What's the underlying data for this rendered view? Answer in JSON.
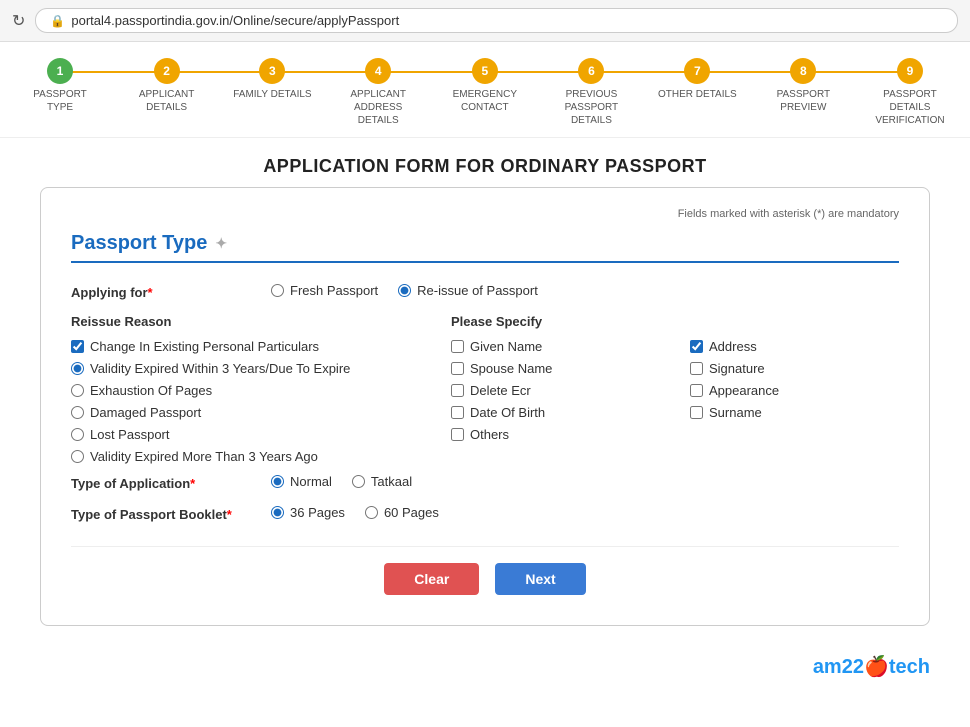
{
  "browser": {
    "url": "portal4.passportindia.gov.in/Online/secure/applyPassport",
    "refresh_icon": "↻",
    "lock_icon": "🔒"
  },
  "steps": [
    {
      "number": "1",
      "label": "PASSPORT TYPE",
      "state": "active"
    },
    {
      "number": "2",
      "label": "APPLICANT DETAILS",
      "state": "pending"
    },
    {
      "number": "3",
      "label": "FAMILY DETAILS",
      "state": "pending"
    },
    {
      "number": "4",
      "label": "APPLICANT ADDRESS DETAILS",
      "state": "pending"
    },
    {
      "number": "5",
      "label": "EMERGENCY CONTACT",
      "state": "pending"
    },
    {
      "number": "6",
      "label": "PREVIOUS PASSPORT DETAILS",
      "state": "pending"
    },
    {
      "number": "7",
      "label": "OTHER DETAILS",
      "state": "pending"
    },
    {
      "number": "8",
      "label": "PASSPORT PREVIEW",
      "state": "pending"
    },
    {
      "number": "9",
      "label": "PASSPORT DETAILS VERIFICATION",
      "state": "pending"
    }
  ],
  "page": {
    "title": "APPLICATION FORM FOR ORDINARY PASSPORT"
  },
  "form": {
    "mandatory_note": "Fields marked with asterisk (*) are mandatory",
    "section_title": "Passport Type",
    "applying_for_label": "Applying for",
    "applying_for_options": [
      "Fresh Passport",
      "Re-issue of Passport"
    ],
    "applying_for_selected": "Re-issue of Passport",
    "reissue_reason_label": "Reissue Reason",
    "reissue_reasons": [
      {
        "label": "Change In Existing Personal Particulars",
        "checked": true,
        "type": "checkbox"
      },
      {
        "label": "Validity Expired Within 3 Years/Due To Expire",
        "checked": true,
        "type": "radio"
      },
      {
        "label": "Exhaustion Of Pages",
        "checked": false,
        "type": "radio"
      },
      {
        "label": "Damaged Passport",
        "checked": false,
        "type": "radio"
      },
      {
        "label": "Lost Passport",
        "checked": false,
        "type": "radio"
      },
      {
        "label": "Validity Expired More Than 3 Years Ago",
        "checked": false,
        "type": "radio"
      }
    ],
    "please_specify_label": "Please Specify",
    "please_specify_items": [
      {
        "label": "Given Name",
        "checked": false
      },
      {
        "label": "Address",
        "checked": true
      },
      {
        "label": "Spouse Name",
        "checked": false
      },
      {
        "label": "Signature",
        "checked": false
      },
      {
        "label": "Delete Ecr",
        "checked": false
      },
      {
        "label": "Appearance",
        "checked": false
      },
      {
        "label": "Date Of Birth",
        "checked": false
      },
      {
        "label": "Surname",
        "checked": false
      },
      {
        "label": "Others",
        "checked": false
      }
    ],
    "type_of_application_label": "Type of Application",
    "type_of_application_options": [
      "Normal",
      "Tatkaal"
    ],
    "type_of_application_selected": "Normal",
    "type_of_booklet_label": "Type of Passport Booklet",
    "type_of_booklet_options": [
      "36 Pages",
      "60 Pages"
    ],
    "type_of_booklet_selected": "36 Pages",
    "clear_button": "Clear",
    "next_button": "Next"
  },
  "branding": {
    "text": "am22tech",
    "icon": "🍎"
  }
}
